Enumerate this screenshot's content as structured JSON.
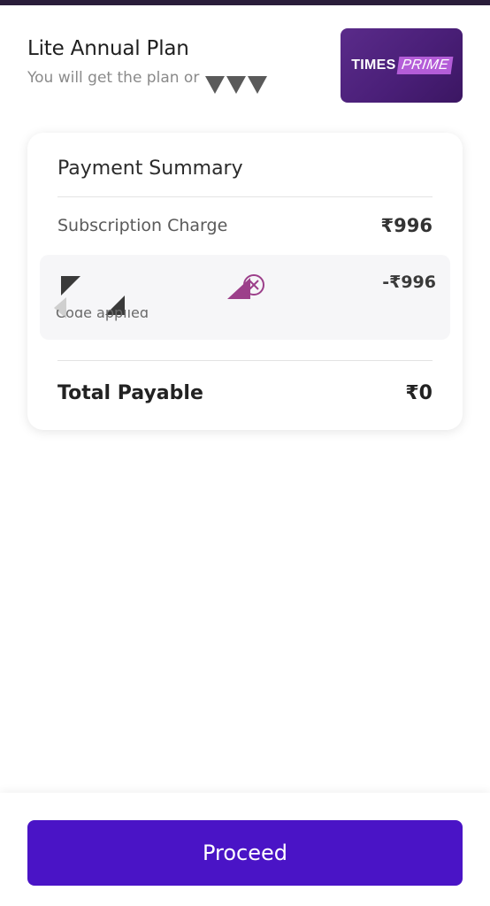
{
  "header": {
    "plan_title": "Lite Annual Plan",
    "plan_subtitle": "You will get the plan or",
    "logo": {
      "times_text": "TIMES",
      "prime_text": "PRIME",
      "bg_color": "#4a1f78",
      "accent_color": "#b45dd8"
    }
  },
  "summary": {
    "title": "Payment Summary",
    "subscription_label": "Subscription Charge",
    "subscription_value": "₹996",
    "coupon": {
      "caption": "Code applied",
      "discount_value": "-₹996",
      "remove_icon": "coupon-remove-icon"
    },
    "total_label": "Total Payable",
    "total_value": "₹0"
  },
  "footer": {
    "proceed_label": "Proceed",
    "button_color": "#4a14c6"
  }
}
